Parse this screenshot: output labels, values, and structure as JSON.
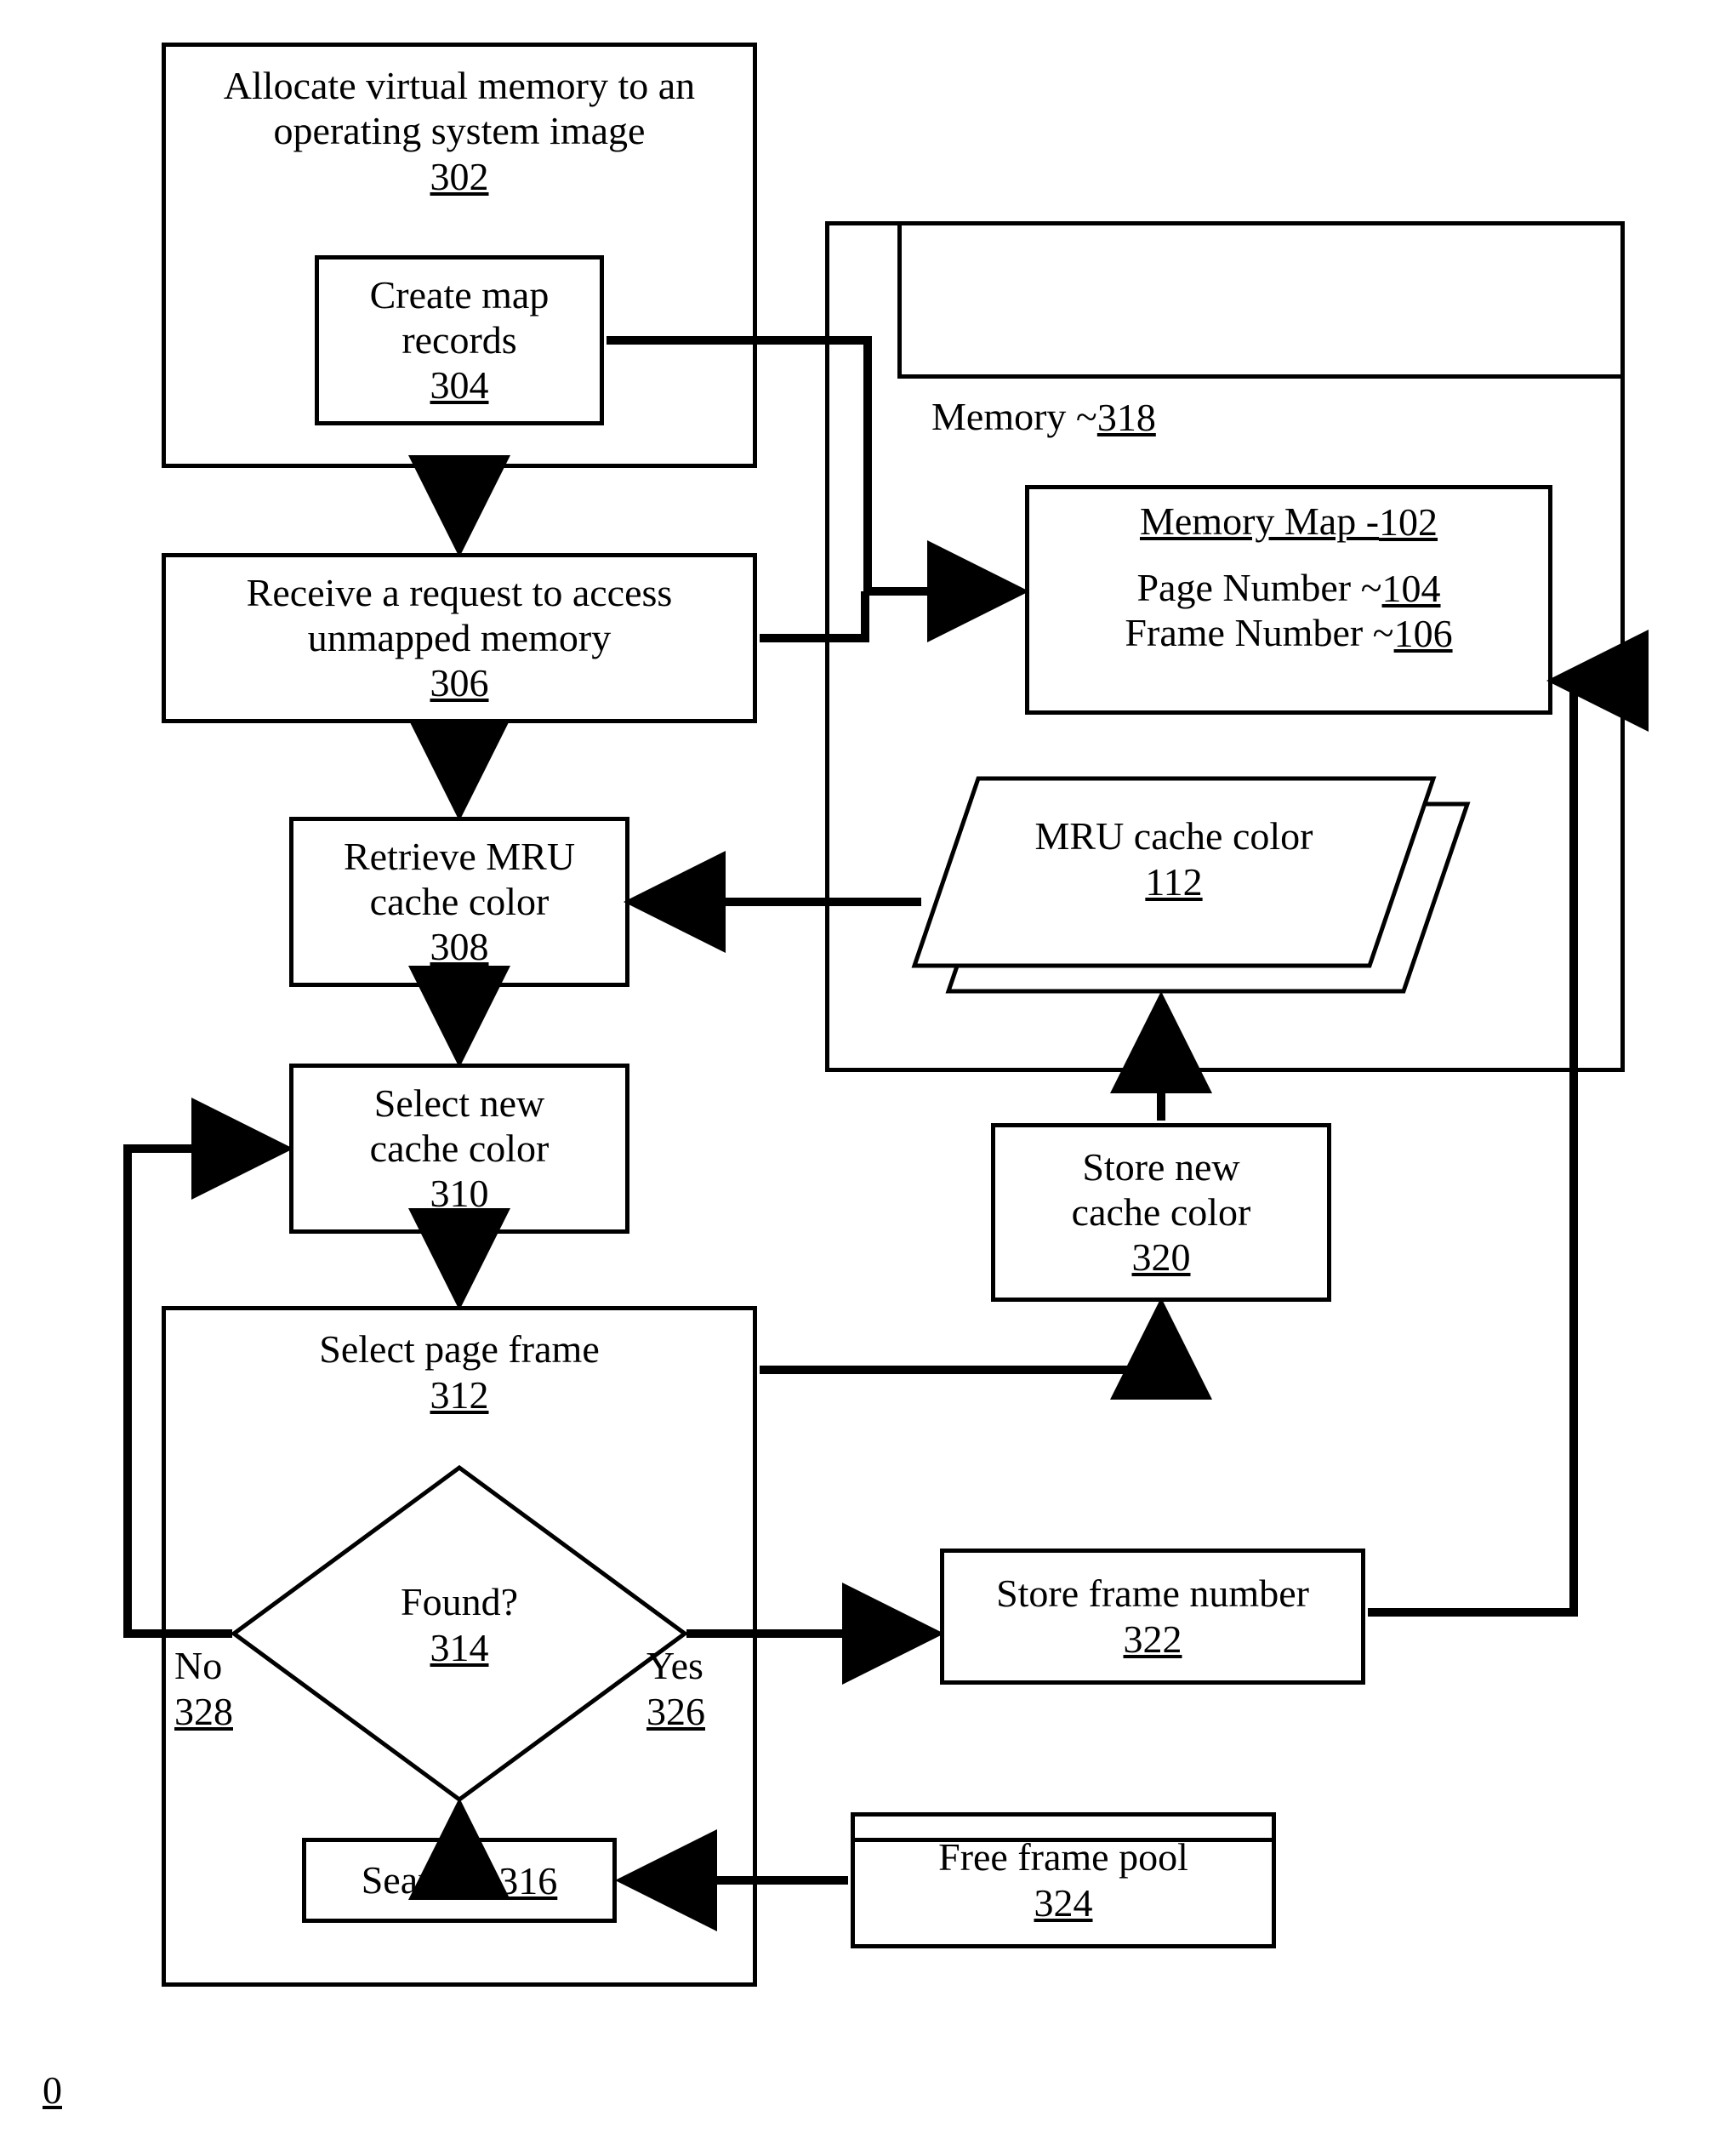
{
  "nodes": {
    "allocate": {
      "line1": "Allocate virtual memory to an",
      "line2": "operating system image",
      "ref": "302"
    },
    "create_map": {
      "line1": "Create map",
      "line2": "records",
      "ref": "304"
    },
    "receive_request": {
      "line1": "Receive a request to access",
      "line2": "unmapped memory",
      "ref": "306"
    },
    "retrieve_mru": {
      "line1": "Retrieve MRU",
      "line2": "cache color",
      "ref": "308"
    },
    "select_new_cc": {
      "line1": "Select new",
      "line2": "cache color",
      "ref": "310"
    },
    "select_pf": {
      "line1": "Select page frame",
      "ref": "312"
    },
    "found": {
      "label": "Found?",
      "ref": "314"
    },
    "search": {
      "label": "Search ~ ",
      "ref": "316"
    },
    "memory": {
      "label": "Memory ~ ",
      "ref": "318"
    },
    "memory_map": {
      "title": "Memory Map - ",
      "title_ref": "102",
      "page": "Page Number ~ ",
      "page_ref": "104",
      "frame": "Frame Number ~ ",
      "frame_ref": "106"
    },
    "mru_cc": {
      "line1": "MRU cache color",
      "ref": "112"
    },
    "store_new_cc": {
      "line1": "Store new",
      "line2": "cache color",
      "ref": "320"
    },
    "store_frame": {
      "line1": "Store frame number",
      "ref": "322"
    },
    "free_pool": {
      "line1": "Free frame pool",
      "ref": "324"
    },
    "yes": {
      "label": "Yes",
      "ref": "326"
    },
    "no": {
      "label": "No",
      "ref": "328"
    }
  },
  "footer_ref": "0"
}
